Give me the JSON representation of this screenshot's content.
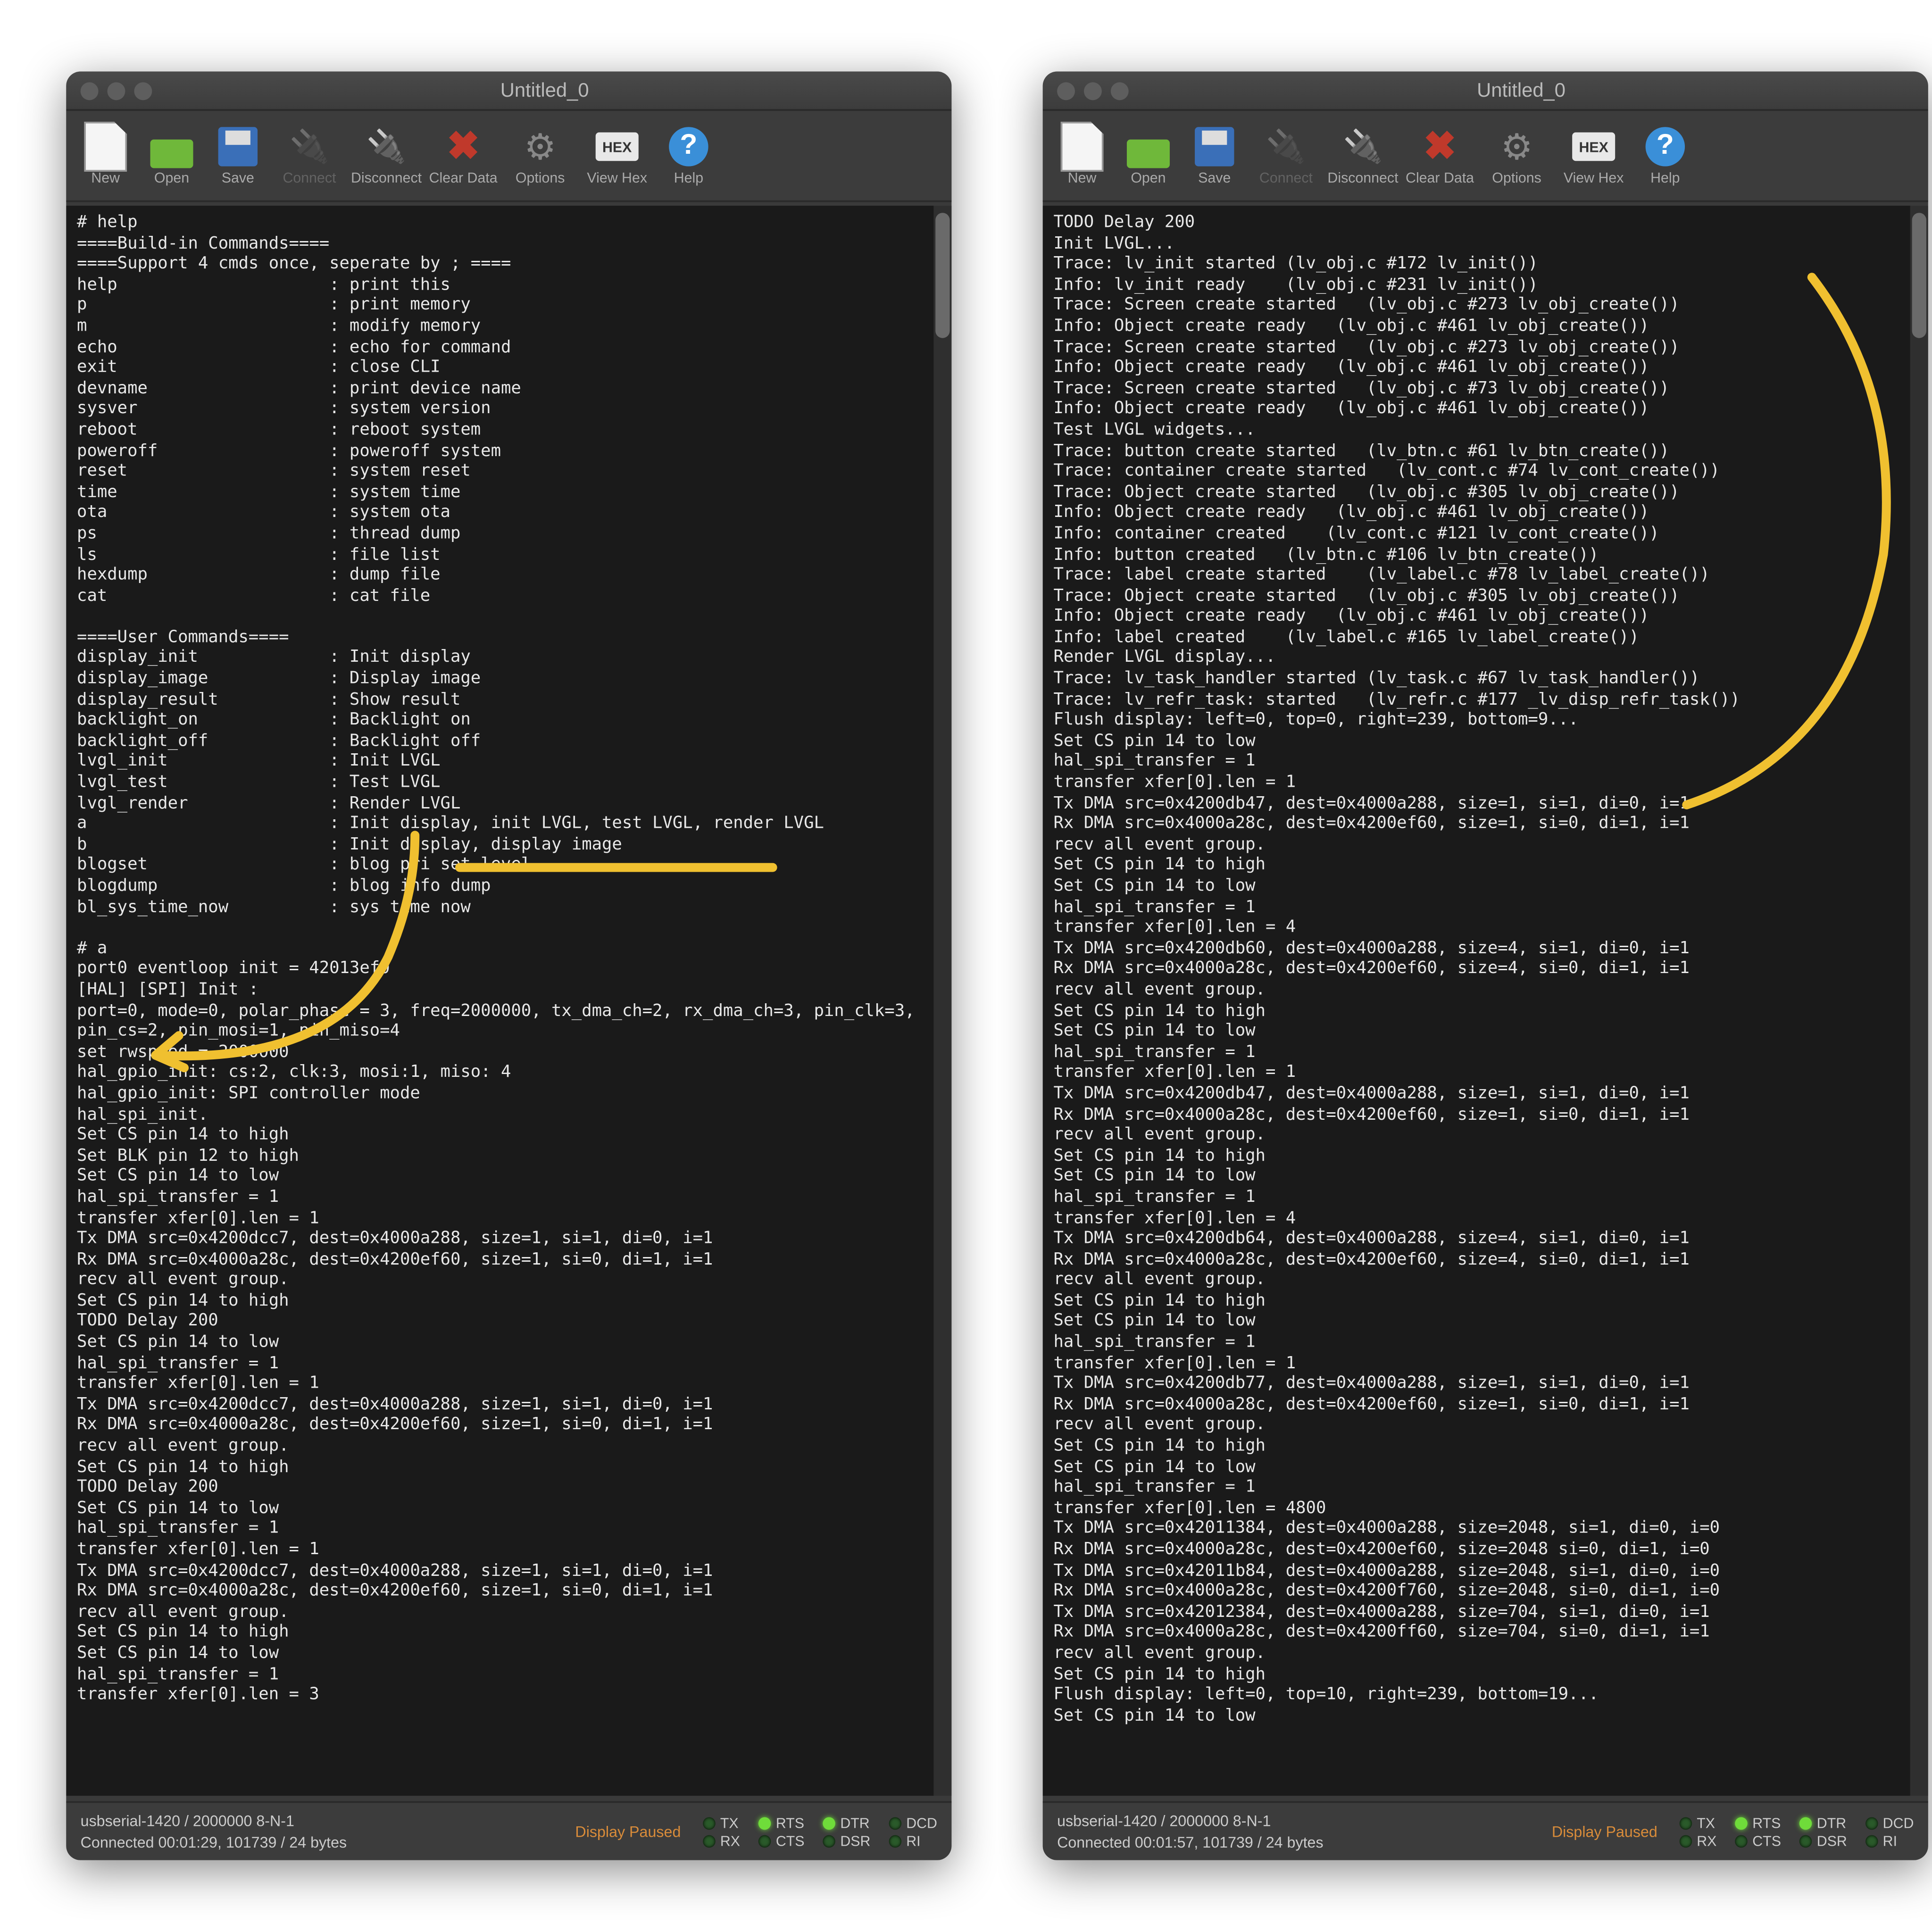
{
  "title": "Untitled_0",
  "toolbar": {
    "new": "New",
    "open": "Open",
    "save": "Save",
    "connect": "Connect",
    "disconnect": "Disconnect",
    "clear": "Clear Data",
    "options": "Options",
    "viewhex": "View Hex",
    "help": "Help",
    "hex": "HEX"
  },
  "status": {
    "port": "usbserial-1420 / 2000000 8-N-1",
    "conn1": "Connected 00:01:29, 101739 / 24 bytes",
    "conn2": "Connected 00:01:57, 101739 / 24 bytes",
    "paused": "Display Paused",
    "sigs": [
      "TX",
      "RTS",
      "DTR",
      "DCD",
      "RX",
      "CTS",
      "DSR",
      "RI"
    ]
  },
  "term1": "# help\n====Build-in Commands====\n====Support 4 cmds once, seperate by ; ====\nhelp                     : print this\np                        : print memory\nm                        : modify memory\necho                     : echo for command\nexit                     : close CLI\ndevname                  : print device name\nsysver                   : system version\nreboot                   : reboot system\npoweroff                 : poweroff system\nreset                    : system reset\ntime                     : system time\nota                      : system ota\nps                       : thread dump\nls                       : file list\nhexdump                  : dump file\ncat                      : cat file\n\n====User Commands====\ndisplay_init             : Init display\ndisplay_image            : Display image\ndisplay_result           : Show result\nbacklight_on             : Backlight on\nbacklight_off            : Backlight off\nlvgl_init                : Init LVGL\nlvgl_test                : Test LVGL\nlvgl_render              : Render LVGL\na                        : Init display, init LVGL, test LVGL, render LVGL\nb                        : Init display, display image\nblogset                  : blog pri set level\nblogdump                 : blog info dump\nbl_sys_time_now          : sys time now\n\n# a\nport0 eventloop init = 42013ef0\n[HAL] [SPI] Init :\nport=0, mode=0, polar_phase = 3, freq=2000000, tx_dma_ch=2, rx_dma_ch=3, pin_clk=3,\npin_cs=2, pin_mosi=1, pin_miso=4\nset rwspeed = 2000000\nhal_gpio_init: cs:2, clk:3, mosi:1, miso: 4\nhal_gpio_init: SPI controller mode\nhal_spi_init.\nSet CS pin 14 to high\nSet BLK pin 12 to high\nSet CS pin 14 to low\nhal_spi_transfer = 1\ntransfer xfer[0].len = 1\nTx DMA src=0x4200dcc7, dest=0x4000a288, size=1, si=1, di=0, i=1\nRx DMA src=0x4000a28c, dest=0x4200ef60, size=1, si=0, di=1, i=1\nrecv all event group.\nSet CS pin 14 to high\nTODO Delay 200\nSet CS pin 14 to low\nhal_spi_transfer = 1\ntransfer xfer[0].len = 1\nTx DMA src=0x4200dcc7, dest=0x4000a288, size=1, si=1, di=0, i=1\nRx DMA src=0x4000a28c, dest=0x4200ef60, size=1, si=0, di=1, i=1\nrecv all event group.\nSet CS pin 14 to high\nTODO Delay 200\nSet CS pin 14 to low\nhal_spi_transfer = 1\ntransfer xfer[0].len = 1\nTx DMA src=0x4200dcc7, dest=0x4000a288, size=1, si=1, di=0, i=1\nRx DMA src=0x4000a28c, dest=0x4200ef60, size=1, si=0, di=1, i=1\nrecv all event group.\nSet CS pin 14 to high\nSet CS pin 14 to low\nhal_spi_transfer = 1\ntransfer xfer[0].len = 3",
  "term2": "TODO Delay 200\nInit LVGL...\nTrace: lv_init started (lv_obj.c #172 lv_init())\nInfo: lv_init ready    (lv_obj.c #231 lv_init())\nTrace: Screen create started   (lv_obj.c #273 lv_obj_create())\nInfo: Object create ready   (lv_obj.c #461 lv_obj_create())\nTrace: Screen create started   (lv_obj.c #273 lv_obj_create())\nInfo: Object create ready   (lv_obj.c #461 lv_obj_create())\nTrace: Screen create started   (lv_obj.c #73 lv_obj_create())\nInfo: Object create ready   (lv_obj.c #461 lv_obj_create())\nTest LVGL widgets...\nTrace: button create started   (lv_btn.c #61 lv_btn_create())\nTrace: container create started   (lv_cont.c #74 lv_cont_create())\nTrace: Object create started   (lv_obj.c #305 lv_obj_create())\nInfo: Object create ready   (lv_obj.c #461 lv_obj_create())\nInfo: container created    (lv_cont.c #121 lv_cont_create())\nInfo: button created   (lv_btn.c #106 lv_btn_create())\nTrace: label create started    (lv_label.c #78 lv_label_create())\nTrace: Object create started   (lv_obj.c #305 lv_obj_create())\nInfo: Object create ready   (lv_obj.c #461 lv_obj_create())\nInfo: label created    (lv_label.c #165 lv_label_create())\nRender LVGL display...\nTrace: lv_task_handler started (lv_task.c #67 lv_task_handler())\nTrace: lv_refr_task: started   (lv_refr.c #177 _lv_disp_refr_task())\nFlush display: left=0, top=0, right=239, bottom=9...\nSet CS pin 14 to low\nhal_spi_transfer = 1\ntransfer xfer[0].len = 1\nTx DMA src=0x4200db47, dest=0x4000a288, size=1, si=1, di=0, i=1\nRx DMA src=0x4000a28c, dest=0x4200ef60, size=1, si=0, di=1, i=1\nrecv all event group.\nSet CS pin 14 to high\nSet CS pin 14 to low\nhal_spi_transfer = 1\ntransfer xfer[0].len = 4\nTx DMA src=0x4200db60, dest=0x4000a288, size=4, si=1, di=0, i=1\nRx DMA src=0x4000a28c, dest=0x4200ef60, size=4, si=0, di=1, i=1\nrecv all event group.\nSet CS pin 14 to high\nSet CS pin 14 to low\nhal_spi_transfer = 1\ntransfer xfer[0].len = 1\nTx DMA src=0x4200db47, dest=0x4000a288, size=1, si=1, di=0, i=1\nRx DMA src=0x4000a28c, dest=0x4200ef60, size=1, si=0, di=1, i=1\nrecv all event group.\nSet CS pin 14 to high\nSet CS pin 14 to low\nhal_spi_transfer = 1\ntransfer xfer[0].len = 4\nTx DMA src=0x4200db64, dest=0x4000a288, size=4, si=1, di=0, i=1\nRx DMA src=0x4000a28c, dest=0x4200ef60, size=4, si=0, di=1, i=1\nrecv all event group.\nSet CS pin 14 to high\nSet CS pin 14 to low\nhal_spi_transfer = 1\ntransfer xfer[0].len = 1\nTx DMA src=0x4200db77, dest=0x4000a288, size=1, si=1, di=0, i=1\nRx DMA src=0x4000a28c, dest=0x4200ef60, size=1, si=0, di=1, i=1\nrecv all event group.\nSet CS pin 14 to high\nSet CS pin 14 to low\nhal_spi_transfer = 1\ntransfer xfer[0].len = 4800\nTx DMA src=0x42011384, dest=0x4000a288, size=2048, si=1, di=0, i=0\nRx DMA src=0x4000a28c, dest=0x4200ef60, size=2048 si=0, di=1, i=0\nTx DMA src=0x42011b84, dest=0x4000a288, size=2048, si=1, di=0, i=0\nRx DMA src=0x4000a28c, dest=0x4200f760, size=2048, si=0, di=1, i=0\nTx DMA src=0x42012384, dest=0x4000a288, size=704, si=1, di=0, i=1\nRx DMA src=0x4000a28c, dest=0x4200ff60, size=704, si=0, di=1, i=1\nrecv all event group.\nSet CS pin 14 to high\nFlush display: left=0, top=10, right=239, bottom=19...\nSet CS pin 14 to low"
}
